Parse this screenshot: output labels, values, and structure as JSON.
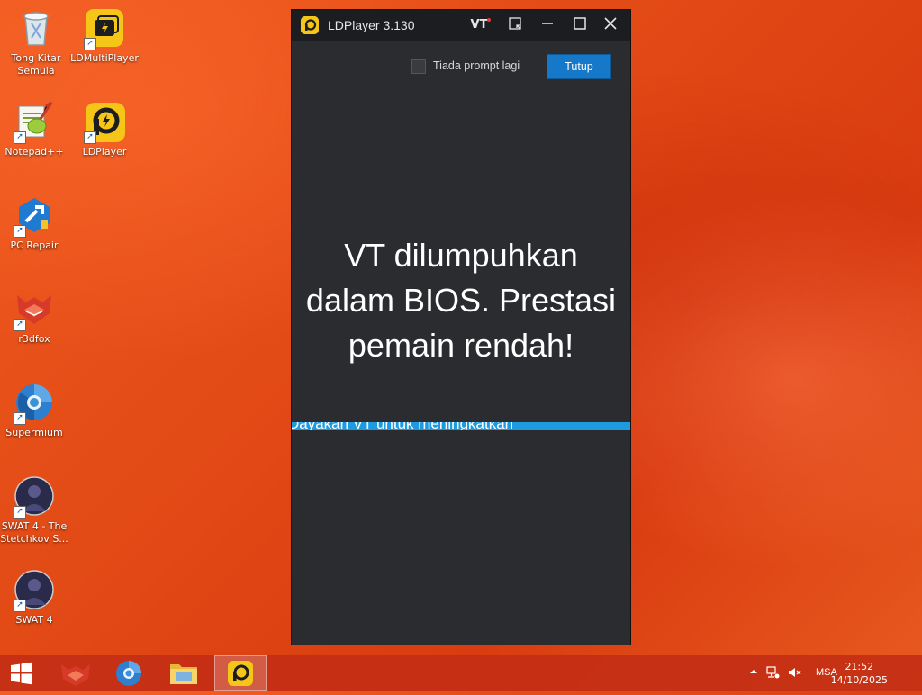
{
  "desktop": {
    "icons": [
      {
        "label": "Tong Kitar Semula"
      },
      {
        "label": "LDMultiPlayer"
      },
      {
        "label": "Notepad++"
      },
      {
        "label": "LDPlayer"
      },
      {
        "label": "PC Repair"
      },
      {
        "label": "r3dfox"
      },
      {
        "label": "Supermium"
      },
      {
        "label": "SWAT 4 - The Stetchkov S..."
      },
      {
        "label": "SWAT 4"
      }
    ]
  },
  "window": {
    "title": "LDPlayer 3.130",
    "vt_badge": "VT",
    "prompt_checkbox_label": "Tiada prompt lagi",
    "close_button_label": "Tutup",
    "message_lines": [
      "VT dilumpuhkan",
      "dalam BIOS. Prestasi",
      "pemain rendah!"
    ],
    "banner_text": "Dayakan VT untuk meningkatkan"
  },
  "taskbar": {
    "language": "MSA",
    "time": "21:52",
    "date": "14/10/2025"
  },
  "colors": {
    "window_bg": "#2b2c30",
    "titlebar_bg": "#1c1d20",
    "accent_button": "#1678c8",
    "banner": "#1e9be0",
    "ld_yellow": "#f5c518"
  }
}
